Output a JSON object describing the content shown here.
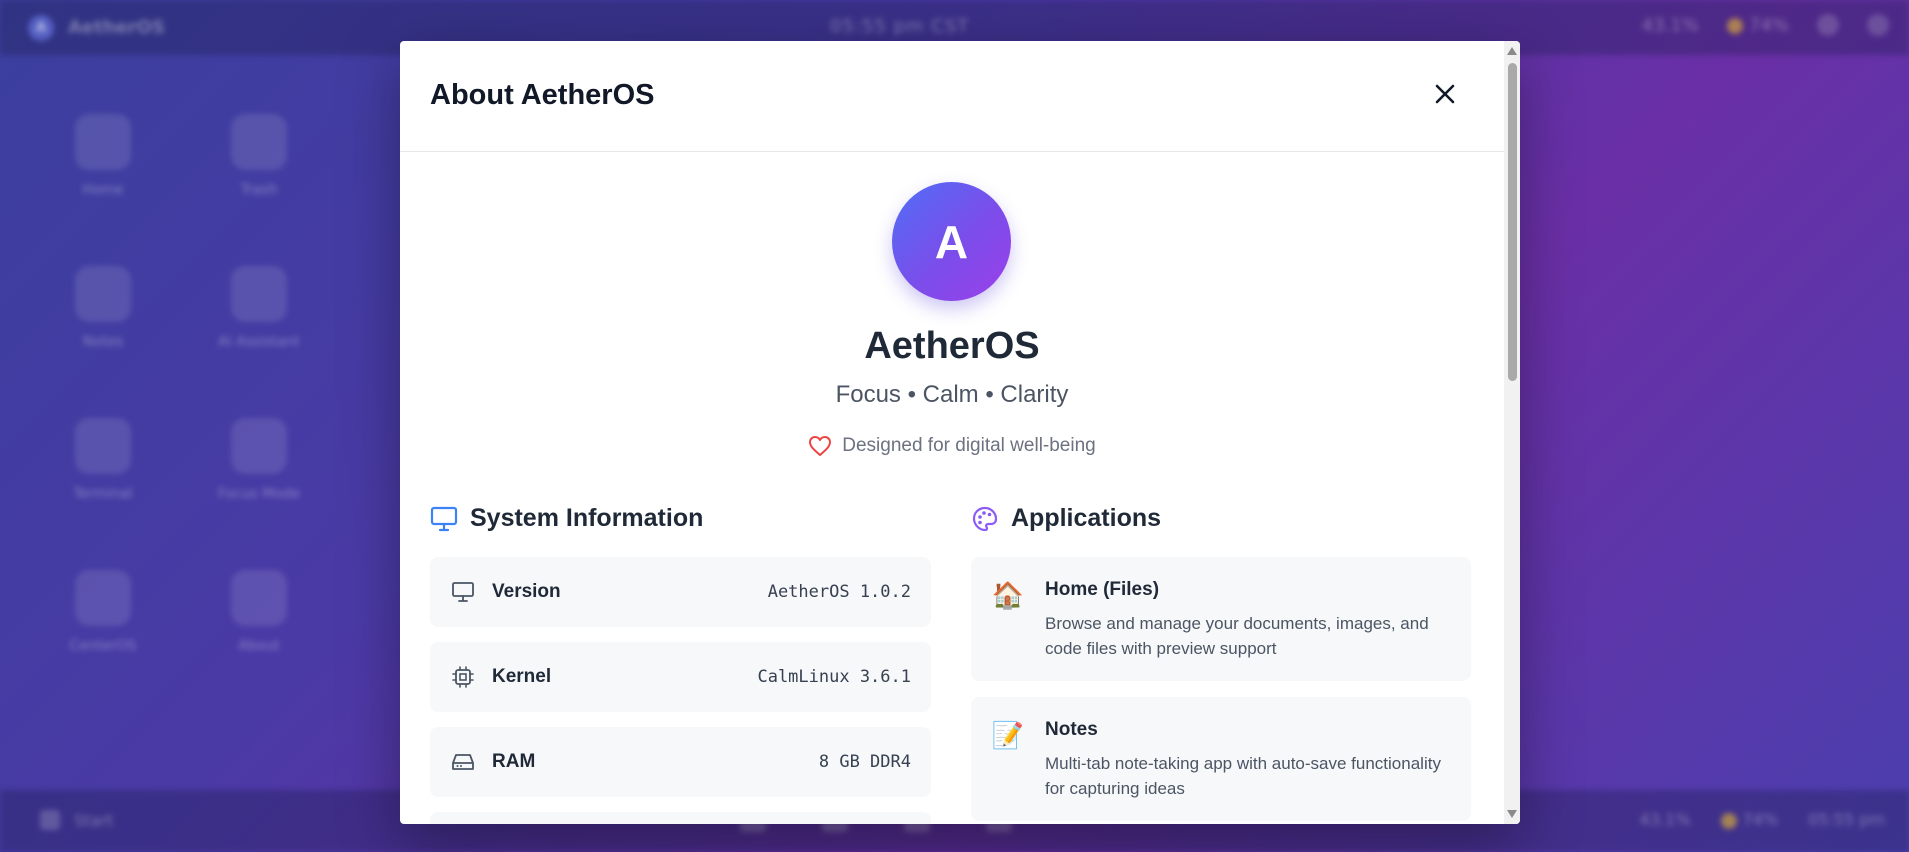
{
  "desktop": {
    "os_name": "AetherOS",
    "logo_letter": "A",
    "clock": "05:55 pm CST",
    "top_status": [
      "43.1%",
      "74%"
    ],
    "icons": [
      {
        "label": "Home"
      },
      {
        "label": "Trash"
      },
      {
        "label": "Notes"
      },
      {
        "label": "AI Assistant"
      },
      {
        "label": "Terminal"
      },
      {
        "label": "Focus Mode"
      },
      {
        "label": "CenterOS"
      },
      {
        "label": "About"
      }
    ],
    "taskbar": {
      "start_label": "Start",
      "status": [
        "43.1%",
        "74%",
        "05:55 pm"
      ]
    }
  },
  "modal": {
    "title": "About AetherOS",
    "logo_letter": "A",
    "name": "AetherOS",
    "tagline": "Focus • Calm • Clarity",
    "note": "Designed for digital well-being",
    "system": {
      "heading": "System Information",
      "rows": [
        {
          "label": "Version",
          "value": "AetherOS 1.0.2",
          "icon": "monitor-icon"
        },
        {
          "label": "Kernel",
          "value": "CalmLinux 3.6.1",
          "icon": "cpu-icon"
        },
        {
          "label": "RAM",
          "value": "8 GB DDR4",
          "icon": "hard-drive-icon"
        }
      ]
    },
    "apps": {
      "heading": "Applications",
      "items": [
        {
          "name": "Home (Files)",
          "description": "Browse and manage your documents, images, and code files with preview support",
          "icon": "🏠"
        },
        {
          "name": "Notes",
          "description": "Multi-tab note-taking app with auto-save functionality for capturing ideas",
          "icon": "📝"
        }
      ]
    }
  },
  "colors": {
    "accent_blue": "#3b82f6",
    "accent_purple": "#8b5cf6",
    "heart_red": "#ef4444"
  }
}
